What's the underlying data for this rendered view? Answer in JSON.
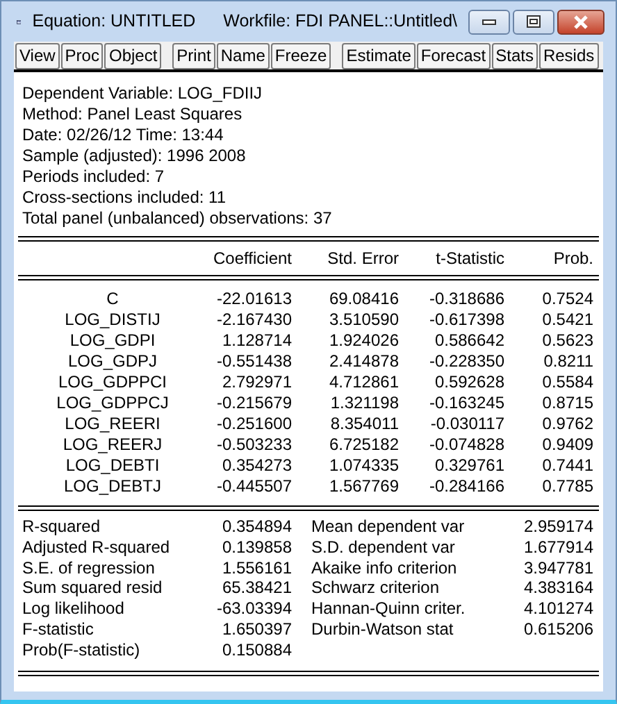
{
  "window": {
    "title": "Equation: UNTITLED",
    "workfile": "Workfile: FDI PANEL::Untitled\\"
  },
  "toolbar": [
    {
      "buttons": [
        "View",
        "Proc",
        "Object"
      ]
    },
    {
      "buttons": [
        "Print",
        "Name",
        "Freeze"
      ]
    },
    {
      "buttons": [
        "Estimate",
        "Forecast",
        "Stats",
        "Resids"
      ]
    }
  ],
  "header": [
    "Dependent Variable: LOG_FDIIJ",
    "Method: Panel Least Squares",
    "Date: 02/26/12   Time: 13:44",
    "Sample (adjusted): 1996 2008",
    "Periods included: 7",
    "Cross-sections included: 11",
    "Total panel (unbalanced) observations: 37"
  ],
  "table": {
    "columns": [
      "Coefficient",
      "Std. Error",
      "t-Statistic",
      "Prob."
    ],
    "rows": [
      {
        "variable": "C",
        "coefficient": "-22.01613",
        "std_error": "69.08416",
        "t_statistic": "-0.318686",
        "prob": "0.7524"
      },
      {
        "variable": "LOG_DISTIJ",
        "coefficient": "-2.167430",
        "std_error": "3.510590",
        "t_statistic": "-0.617398",
        "prob": "0.5421"
      },
      {
        "variable": "LOG_GDPI",
        "coefficient": "1.128714",
        "std_error": "1.924026",
        "t_statistic": "0.586642",
        "prob": "0.5623"
      },
      {
        "variable": "LOG_GDPJ",
        "coefficient": "-0.551438",
        "std_error": "2.414878",
        "t_statistic": "-0.228350",
        "prob": "0.8211"
      },
      {
        "variable": "LOG_GDPPCI",
        "coefficient": "2.792971",
        "std_error": "4.712861",
        "t_statistic": "0.592628",
        "prob": "0.5584"
      },
      {
        "variable": "LOG_GDPPCJ",
        "coefficient": "-0.215679",
        "std_error": "1.321198",
        "t_statistic": "-0.163245",
        "prob": "0.8715"
      },
      {
        "variable": "LOG_REERI",
        "coefficient": "-0.251600",
        "std_error": "8.354011",
        "t_statistic": "-0.030117",
        "prob": "0.9762"
      },
      {
        "variable": "LOG_REERJ",
        "coefficient": "-0.503233",
        "std_error": "6.725182",
        "t_statistic": "-0.074828",
        "prob": "0.9409"
      },
      {
        "variable": "LOG_DEBTI",
        "coefficient": "0.354273",
        "std_error": "1.074335",
        "t_statistic": "0.329761",
        "prob": "0.7441"
      },
      {
        "variable": "LOG_DEBTJ",
        "coefficient": "-0.445507",
        "std_error": "1.567769",
        "t_statistic": "-0.284166",
        "prob": "0.7785"
      }
    ]
  },
  "statistics": [
    {
      "label": "R-squared",
      "value": "0.354894",
      "label_2": "Mean dependent var",
      "value_2": "2.959174"
    },
    {
      "label": "Adjusted R-squared",
      "value": "0.139858",
      "label_2": "S.D. dependent var",
      "value_2": "1.677914"
    },
    {
      "label": "S.E. of regression",
      "value": "1.556161",
      "label_2": "Akaike info criterion",
      "value_2": "3.947781"
    },
    {
      "label": "Sum squared resid",
      "value": "65.38421",
      "label_2": "Schwarz criterion",
      "value_2": "4.383164"
    },
    {
      "label": "Log likelihood",
      "value": "-63.03394",
      "label_2": "Hannan-Quinn criter.",
      "value_2": "4.101274"
    },
    {
      "label": "F-statistic",
      "value": "1.650397",
      "label_2": "Durbin-Watson stat",
      "value_2": "0.615206"
    },
    {
      "label": "Prob(F-statistic)",
      "value": "0.150884"
    }
  ]
}
